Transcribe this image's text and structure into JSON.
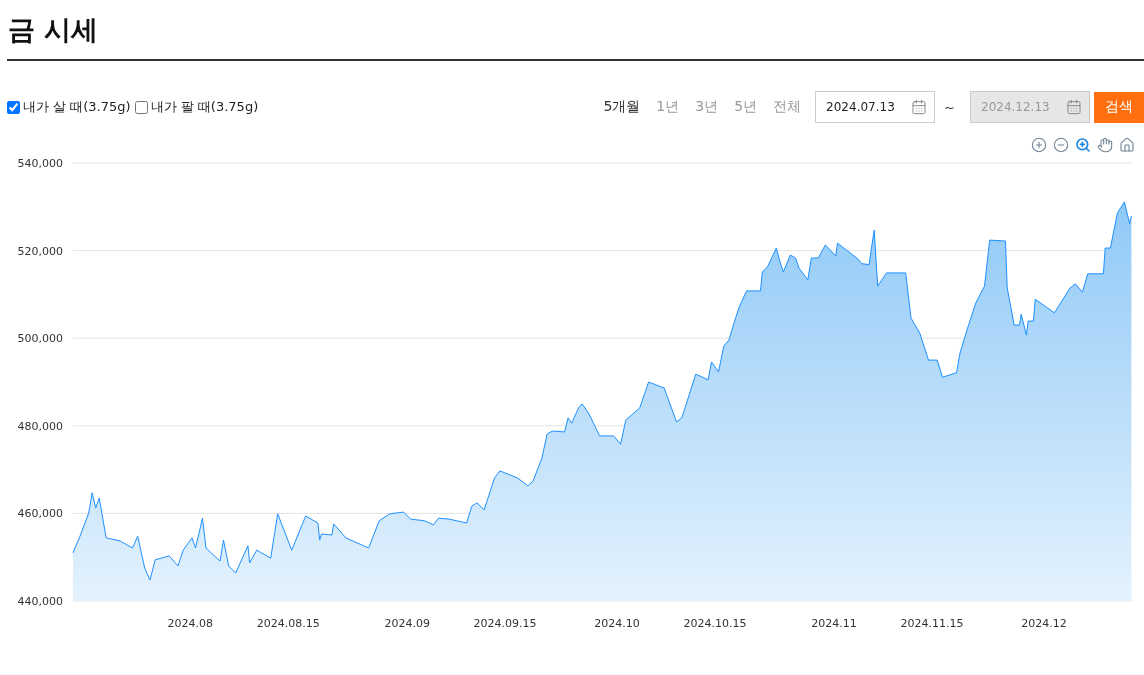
{
  "title": "금 시세",
  "options": [
    {
      "label": "내가 살 때(3.75g)",
      "checked": true
    },
    {
      "label": "내가 팔 때(3.75g)",
      "checked": false
    }
  ],
  "periods": [
    {
      "label": "5개월",
      "selected": true
    },
    {
      "label": "1년",
      "selected": false
    },
    {
      "label": "3년",
      "selected": false
    },
    {
      "label": "5년",
      "selected": false
    },
    {
      "label": "전체",
      "selected": false
    }
  ],
  "date_from": {
    "value": "2024.07.13",
    "disabled": false
  },
  "separator": "~",
  "date_to": {
    "value": "2024.12.13",
    "disabled": true
  },
  "search_button": "검색",
  "chart": {
    "tools": [
      {
        "kind": "zoom-in",
        "selected": false
      },
      {
        "kind": "zoom-out",
        "selected": false
      },
      {
        "kind": "selection-zoom",
        "selected": true
      },
      {
        "kind": "pan",
        "selected": false
      },
      {
        "kind": "reset",
        "selected": false
      }
    ],
    "chart_data": {
      "type": "area",
      "x": [
        "2024-07-15T06:00",
        "2024-07-16T06:00",
        "2024-07-17T12:00",
        "2024-07-18T00:00",
        "2024-07-18T12:00",
        "2024-07-19T00:00",
        "2024-07-20T00:00",
        "2024-07-22T00:00",
        "2024-07-23T18:00",
        "2024-07-24T12:00",
        "2024-07-25T12:00",
        "2024-07-26T06:00",
        "2024-07-27T00:00",
        "2024-07-29T00:00",
        "2024-07-30T06:00",
        "2024-07-31T00:00",
        "2024-08-01T06:00",
        "2024-08-01T18:00",
        "2024-08-02T18:00",
        "2024-08-03T06:00",
        "2024-08-05T06:00",
        "2024-08-05T18:00",
        "2024-08-06T12:00",
        "2024-08-07T12:00",
        "2024-08-09T06:00",
        "2024-08-09T12:00",
        "2024-08-10T12:00",
        "2024-08-12T12:00",
        "2024-08-13T12:00",
        "2024-08-15T12:00",
        "2024-08-17T12:00",
        "2024-08-19T06:00",
        "2024-08-19T12:00",
        "2024-08-19T18:00",
        "2024-08-21T06:00",
        "2024-08-21T12:00",
        "2024-08-23T06:00",
        "2024-08-26T12:00",
        "2024-08-28T00:00",
        "2024-08-29T12:00",
        "2024-08-31T12:00",
        "2024-09-01T12:00",
        "2024-09-03T12:00",
        "2024-09-04T18:00",
        "2024-09-05T12:00",
        "2024-09-07T00:00",
        "2024-09-09T12:00",
        "2024-09-10T06:00",
        "2024-09-11T00:00",
        "2024-09-12T00:00",
        "2024-09-13T12:00",
        "2024-09-14T06:00",
        "2024-09-16T18:00",
        "2024-09-18T06:00",
        "2024-09-19T00:00",
        "2024-09-20T06:00",
        "2024-09-21T00:00",
        "2024-09-21T18:00",
        "2024-09-23T12:00",
        "2024-09-24T00:00",
        "2024-09-24T12:00",
        "2024-09-25T12:00",
        "2024-09-26T00:00",
        "2024-09-27T00:00",
        "2024-09-28T12:00",
        "2024-09-30T12:00",
        "2024-10-01T12:00",
        "2024-10-02T06:00",
        "2024-10-04T06:00",
        "2024-10-05T12:00",
        "2024-10-07T18:00",
        "2024-10-08T06:00",
        "2024-10-09T12:00",
        "2024-10-10T06:00",
        "2024-10-12T06:00",
        "2024-10-14T00:00",
        "2024-10-14T12:00",
        "2024-10-15T12:00",
        "2024-10-16T06:00",
        "2024-10-17T00:00",
        "2024-10-17T18:00",
        "2024-10-18T12:00",
        "2024-10-19T12:00",
        "2024-10-21T12:00",
        "2024-10-21T18:00",
        "2024-10-22T12:00",
        "2024-10-23T18:00",
        "2024-10-24T06:00",
        "2024-10-24T18:00",
        "2024-10-25T18:00",
        "2024-10-26T12:00",
        "2024-10-27T00:00",
        "2024-10-28T06:00",
        "2024-10-28T18:00",
        "2024-10-29T18:00",
        "2024-10-30T18:00",
        "2024-11-01T06:00",
        "2024-11-01T12:00",
        "2024-11-04T06:00",
        "2024-11-05T00:00",
        "2024-11-06T00:00",
        "2024-11-06T18:00",
        "2024-11-07T06:00",
        "2024-11-08T12:00",
        "2024-11-11T06:00",
        "2024-11-12T00:00",
        "2024-11-13T06:00",
        "2024-11-14T12:00",
        "2024-11-15T18:00",
        "2024-11-16T12:00",
        "2024-11-18T12:00",
        "2024-11-19T00:00",
        "2024-11-20T00:00",
        "2024-11-21T06:00",
        "2024-11-22T12:00",
        "2024-11-23T06:00",
        "2024-11-25T12:00",
        "2024-11-25T18:00",
        "2024-11-26T18:00",
        "2024-11-27T12:00",
        "2024-11-27T18:00",
        "2024-11-28T12:00",
        "2024-11-28T18:00",
        "2024-11-29T12:00",
        "2024-11-29T18:00",
        "2024-12-02T12:00",
        "2024-12-04T18:00",
        "2024-12-05T12:00",
        "2024-12-06T12:00",
        "2024-12-07T06:00",
        "2024-12-09T12:00",
        "2024-12-09T18:00",
        "2024-12-10T12:00",
        "2024-12-11T12:00",
        "2024-12-12T12:00",
        "2024-12-13T06:00",
        "2024-12-13T12:00"
      ],
      "series": [
        {
          "color": "#1e90ff",
          "values": [
            451000,
            454800,
            460100,
            464700,
            461200,
            463500,
            454400,
            453700,
            452100,
            454800,
            447500,
            444800,
            449400,
            450300,
            448000,
            451600,
            454400,
            452100,
            458900,
            452100,
            449100,
            453900,
            448000,
            446400,
            452600,
            448700,
            451600,
            449800,
            459900,
            451600,
            459400,
            457800,
            453900,
            455300,
            455100,
            457600,
            454400,
            452100,
            458300,
            459900,
            460300,
            458700,
            458300,
            457400,
            458900,
            458700,
            457800,
            461700,
            462400,
            460800,
            468100,
            469700,
            468100,
            466300,
            467400,
            472600,
            478100,
            478800,
            478600,
            481800,
            480600,
            484100,
            485000,
            482700,
            477700,
            477700,
            475800,
            481300,
            484100,
            490000,
            488600,
            486300,
            480900,
            481800,
            491800,
            490500,
            494600,
            492300,
            498200,
            499600,
            503700,
            507300,
            510800,
            510800,
            515100,
            516300,
            520600,
            517600,
            515100,
            519000,
            518300,
            516000,
            513300,
            518300,
            518300,
            521300,
            518800,
            521700,
            518300,
            517000,
            516800,
            524700,
            511900,
            514900,
            514900,
            504600,
            501200,
            495000,
            495000,
            491100,
            492100,
            496600,
            501900,
            508000,
            511900,
            522400,
            522200,
            511500,
            503000,
            503000,
            505500,
            500700,
            503900,
            503900,
            508900,
            505800,
            511500,
            512400,
            510500,
            514700,
            514700,
            520600,
            520600,
            528600,
            531100,
            526100,
            527900
          ]
        }
      ],
      "xlim": [
        "2024-07-15T06:00",
        "2024-12-13T14:00"
      ],
      "grid": true,
      "ylim": [
        440000,
        540000
      ],
      "xticks": [
        {
          "value": "2024-08-01T00:00",
          "label": "2024.08"
        },
        {
          "value": "2024-08-15T00:00",
          "label": "2024.08.15"
        },
        {
          "value": "2024-09-01T00:00",
          "label": "2024.09"
        },
        {
          "value": "2024-09-15T00:00",
          "label": "2024.09.15"
        },
        {
          "value": "2024-10-01T00:00",
          "label": "2024.10"
        },
        {
          "value": "2024-10-15T00:00",
          "label": "2024.10.15"
        },
        {
          "value": "2024-11-01T00:00",
          "label": "2024.11"
        },
        {
          "value": "2024-11-15T00:00",
          "label": "2024.11.15"
        },
        {
          "value": "2024-12-01T00:00",
          "label": "2024.12"
        }
      ],
      "yticks": [
        {
          "value": 440000,
          "label": "440,000"
        },
        {
          "value": 460000,
          "label": "460,000"
        },
        {
          "value": 480000,
          "label": "480,000"
        },
        {
          "value": 500000,
          "label": "500,000"
        },
        {
          "value": 520000,
          "label": "520,000"
        },
        {
          "value": 540000,
          "label": "540,000"
        }
      ]
    }
  }
}
